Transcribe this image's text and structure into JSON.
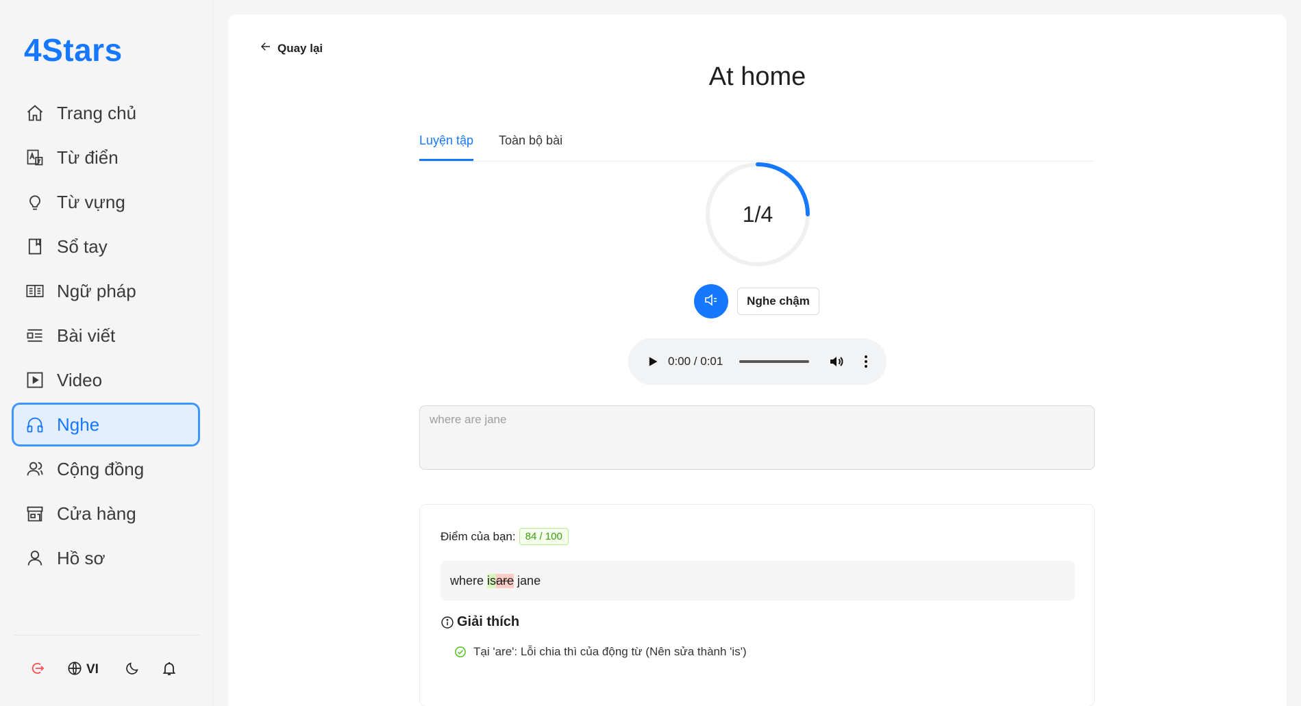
{
  "app": {
    "logo": "4Stars"
  },
  "sidebar": {
    "items": [
      {
        "label": "Trang chủ",
        "icon": "home-icon"
      },
      {
        "label": "Từ điển",
        "icon": "dictionary-icon"
      },
      {
        "label": "Từ vựng",
        "icon": "lightbulb-icon"
      },
      {
        "label": "Sổ tay",
        "icon": "notebook-icon"
      },
      {
        "label": "Ngữ pháp",
        "icon": "book-open-icon"
      },
      {
        "label": "Bài viết",
        "icon": "article-icon"
      },
      {
        "label": "Video",
        "icon": "video-icon"
      },
      {
        "label": "Nghe",
        "icon": "headphones-icon",
        "active": true
      },
      {
        "label": "Cộng đồng",
        "icon": "community-icon"
      },
      {
        "label": "Cửa hàng",
        "icon": "store-icon"
      },
      {
        "label": "Hồ sơ",
        "icon": "profile-icon"
      }
    ],
    "bottom": {
      "language": "VI"
    }
  },
  "page": {
    "back_label": "Quay lại",
    "title": "At home",
    "tabs": [
      {
        "label": "Luyện tập",
        "active": true
      },
      {
        "label": "Toàn bộ bài",
        "active": false
      }
    ],
    "progress": {
      "text": "1/4",
      "current": 1,
      "total": 4
    },
    "slow_label": "Nghe chậm",
    "audio": {
      "time": "0:00 / 0:01"
    },
    "answer_value": "where are jane",
    "result": {
      "score_label": "Điểm của bạn:",
      "score": "84 / 100",
      "diff": {
        "before": "where ",
        "inserted": "is",
        "deleted": "are",
        "after": " jane"
      },
      "explain_title": "Giải thích",
      "explanations": [
        "Tại 'are': Lỗi chia thì của động từ (Nên sửa thành 'is')"
      ]
    }
  },
  "colors": {
    "accent": "#1677ff",
    "success": "#389e0d",
    "error_bg": "#ffccc7",
    "insert_bg": "#d9f7be"
  }
}
